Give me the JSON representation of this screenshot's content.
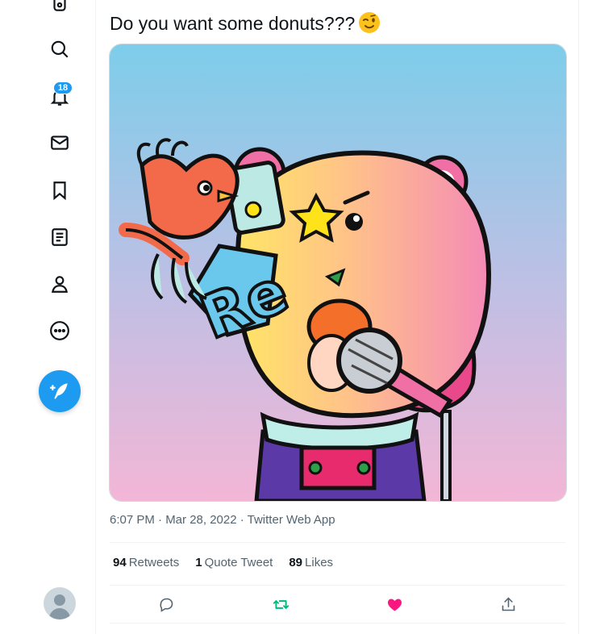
{
  "sidebar": {
    "icons": [
      "home-icon",
      "search-icon",
      "bell-icon",
      "mail-icon",
      "bookmark-icon",
      "list-icon",
      "profile-icon",
      "more-icon"
    ],
    "notifications_count": "18",
    "compose_icon": "feather-plus-icon"
  },
  "tweet": {
    "text": "Do you want some donuts???",
    "emoji": "winking-face-emoji",
    "timestamp": "6:07 PM · Mar 28, 2022 · Twitter Web App",
    "stats": {
      "retweets_count": "94",
      "retweets_label": "Retweets",
      "quotes_count": "1",
      "quotes_label": "Quote Tweet",
      "likes_count": "89",
      "likes_label": "Likes"
    },
    "liked": true,
    "retweeted": true
  },
  "image": {
    "badge_text": "Re",
    "subject": "pink bear with microphone and red bird"
  },
  "colors": {
    "accent": "#1d9bf0",
    "like": "#f91880",
    "retweet": "#00ba7c",
    "muted": "#536471"
  }
}
